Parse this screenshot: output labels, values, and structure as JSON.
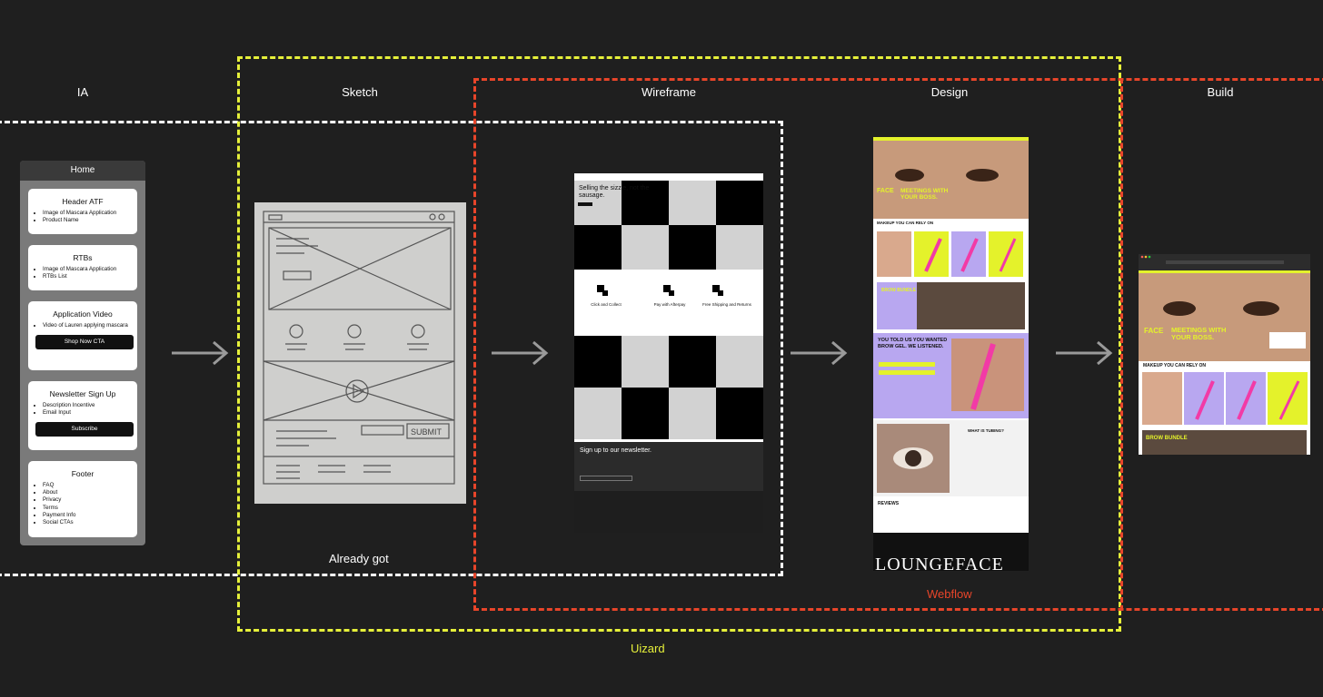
{
  "stages": {
    "ia": "IA",
    "sketch": "Sketch",
    "wireframe": "Wireframe",
    "design": "Design",
    "build": "Build"
  },
  "captions": {
    "already_got": "Already got",
    "webflow": "Webflow",
    "uizard": "Uizard"
  },
  "colors": {
    "white_dash": "#ffffff",
    "yellow_dash": "#e6f03a",
    "red_dash": "#e8452a",
    "arrow": "#9a9a9a",
    "lime": "#e4f22b",
    "purple": "#b8a7f0"
  },
  "ia": {
    "title": "Home",
    "cards": [
      {
        "title": "Header ATF",
        "items": [
          "Image of Mascara Application",
          "Product Name"
        ]
      },
      {
        "title": "RTBs",
        "items": [
          "Image of Mascara Application",
          "RTBs List"
        ]
      },
      {
        "title": "Application Video",
        "items": [
          "Video of Lauren applying mascara"
        ],
        "button": "Shop Now CTA"
      },
      {
        "title": "Newsletter Sign Up",
        "items": [
          "Description Incentive",
          "Email Input"
        ],
        "button": "Subscribe"
      },
      {
        "title": "Footer",
        "items": [
          "FAQ",
          "About",
          "Privacy",
          "Terms",
          "Payment Info",
          "Social CTAs"
        ]
      }
    ]
  },
  "sketch": {
    "submit_text": "SUBMIT"
  },
  "wireframe": {
    "hero_text": "Selling the sizzle, not the sausage.",
    "features": [
      "Click and Collect",
      "Pay with Afterpay",
      "Free Shipping and Returns"
    ],
    "newsletter": "Sign up to our newsletter."
  },
  "design": {
    "hero_face": "FACE",
    "hero_headline": "MEETINGS WITH YOUR BOSS.",
    "section1": "MAKEUP YOU CAN RELY ON",
    "bundle": "BROW BUNDLE",
    "told": "YOU TOLD US YOU WANTED BROW GEL. WE LISTENED.",
    "what": "WHAT IS TUBING?",
    "reviews": "REVIEWS",
    "brand": "LOUNGEFACE"
  },
  "build": {
    "hero_face": "FACE",
    "hero_headline": "MEETINGS WITH YOUR BOSS.",
    "section1": "MAKEUP YOU CAN RELY ON",
    "bundle": "BROW BUNDLE"
  }
}
